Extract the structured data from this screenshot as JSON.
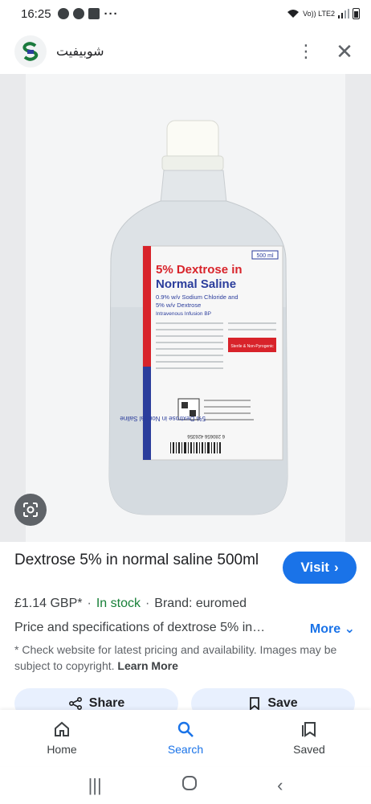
{
  "status_bar": {
    "time": "16:25",
    "more": "···",
    "network": "Vo)) LTE2"
  },
  "header": {
    "site_name": "شوبيفيت",
    "more_label": "⋮",
    "close_label": "✕"
  },
  "product_image": {
    "label_title_1": "5% Dextrose in",
    "label_title_2": "Normal Saline",
    "label_sub_1": "0.9% w/v Sodium Chloride and",
    "label_sub_2": "5% w/v Dextrose",
    "label_sub_3": "Intravenous Infusion BP",
    "volume": "500 ml",
    "sterile": "Sterile & Non-Pyrogenic",
    "rotated_text": "5% Dextrose in Normal Saline",
    "barcode_number": "6 280656 426356"
  },
  "result": {
    "title": "Dextrose 5% in normal saline 500ml",
    "visit_label": "Visit",
    "price": "£1.14 GBP*",
    "stock": "In stock",
    "brand": "Brand: euromed",
    "description": "Price and specifications of dextrose 5% in…",
    "more_label": "More",
    "disclaimer": "* Check website for latest pricing and availability. Images may be subject to copyright.",
    "learn_more": "Learn More"
  },
  "actions": {
    "share_label": "Share",
    "save_label": "Save"
  },
  "bottom_nav": {
    "home": "Home",
    "search": "Search",
    "saved": "Saved"
  },
  "colors": {
    "accent": "#1a73e8",
    "in_stock": "#188038",
    "label_red": "#d8232a",
    "label_blue": "#2b3d9c"
  }
}
